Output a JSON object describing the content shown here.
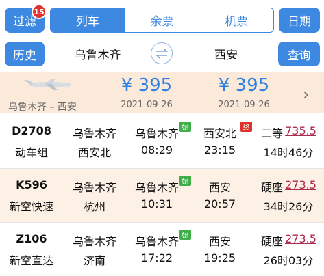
{
  "header": {
    "filter_label": "过滤",
    "filter_badge": "15",
    "tabs": [
      {
        "label": "列车",
        "active": true
      },
      {
        "label": "余票",
        "active": false
      },
      {
        "label": "机票",
        "active": false
      }
    ],
    "date_label": "日期"
  },
  "search": {
    "history_label": "历史",
    "from": "乌鲁木齐",
    "to": "西安",
    "query_label": "查询"
  },
  "flight": {
    "route": "乌鲁木齐 – 西安",
    "prices": [
      {
        "price": "¥ 395",
        "date": "2021-09-26"
      },
      {
        "price": "¥ 395",
        "date": "2021-09-26"
      }
    ]
  },
  "trains": [
    {
      "number": "D2708",
      "type": "动车组",
      "origin": "乌鲁木齐",
      "destination": "西安北",
      "depart_station": "乌鲁木齐",
      "depart_tag": "始",
      "depart_time": "08:29",
      "arrive_station": "西安北",
      "arrive_tag": "终",
      "arrive_time": "23:15",
      "seat": "二等",
      "price": "735.5",
      "duration": "14时46分"
    },
    {
      "number": "K596",
      "type": "新空快速",
      "origin": "乌鲁木齐",
      "destination": "杭州",
      "depart_station": "乌鲁木齐",
      "depart_tag": "始",
      "depart_time": "10:31",
      "arrive_station": "西安",
      "arrive_tag": "",
      "arrive_time": "20:57",
      "seat": "硬座",
      "price": "273.5",
      "duration": "34时26分"
    },
    {
      "number": "Z106",
      "type": "新空直达",
      "origin": "乌鲁木齐",
      "destination": "济南",
      "depart_station": "乌鲁木齐",
      "depart_tag": "始",
      "depart_time": "17:22",
      "arrive_station": "西安",
      "arrive_tag": "",
      "arrive_time": "19:25",
      "seat": "硬座",
      "price": "273.5",
      "duration": "26时03分"
    }
  ],
  "colors": {
    "accent": "#3d88e0",
    "banner_bg": "#fbe9da",
    "alt_row_bg": "#fdf1e6",
    "start_tag": "#3fae49",
    "end_tag": "#e0302c",
    "price_red": "#b02a4d"
  },
  "icons": [
    "airplane-icon",
    "swap-arrows-icon",
    "chevron-right-icon"
  ]
}
